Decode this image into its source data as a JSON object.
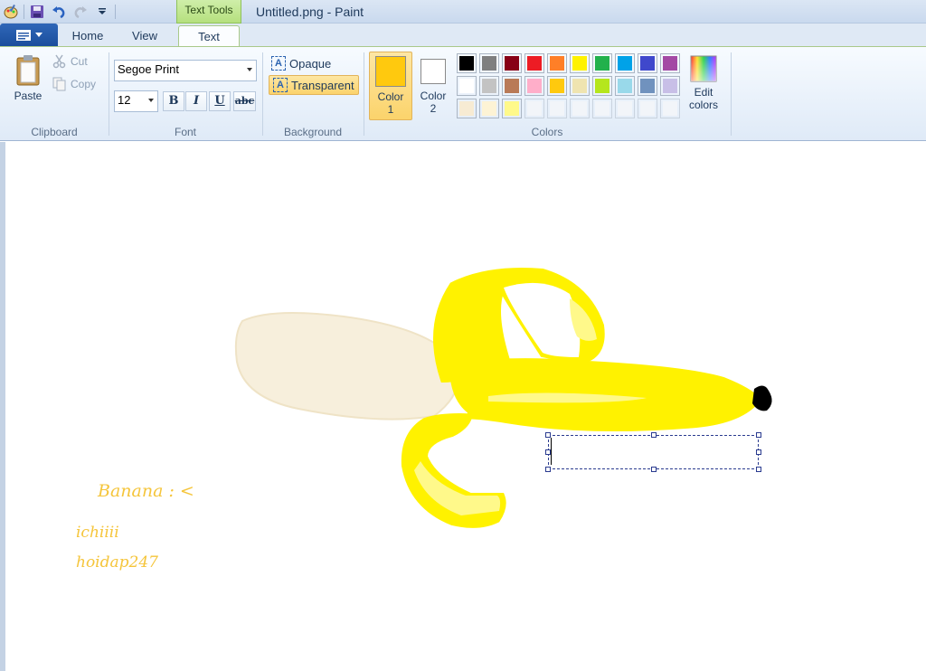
{
  "window": {
    "title": "Untitled.png - Paint",
    "context_tab": "Text Tools"
  },
  "tabs": [
    {
      "label": "Home"
    },
    {
      "label": "View"
    },
    {
      "label": "Text"
    }
  ],
  "clipboard": {
    "paste": "Paste",
    "cut": "Cut",
    "copy": "Copy",
    "group": "Clipboard"
  },
  "font": {
    "family": "Segoe Print",
    "size": "12",
    "bold": "B",
    "italic": "I",
    "underline": "U",
    "strike": "abc",
    "group": "Font"
  },
  "background": {
    "opaque": "Opaque",
    "transparent": "Transparent",
    "group": "Background"
  },
  "colors": {
    "color1_label": "Color",
    "color1_num": "1",
    "color2_label": "Color",
    "color2_num": "2",
    "edit_line1": "Edit",
    "edit_line2": "colors",
    "group": "Colors",
    "color1": "#ffc90e",
    "color2": "#ffffff",
    "palette_row1": [
      "#000000",
      "#7f7f7f",
      "#880015",
      "#ed1c24",
      "#ff7f27",
      "#fff200",
      "#22b14c",
      "#00a2e8",
      "#3f48cc",
      "#a349a4"
    ],
    "palette_row2": [
      "#ffffff",
      "#c3c3c3",
      "#b97a57",
      "#ffaec9",
      "#ffc90e",
      "#efe4b0",
      "#b5e61d",
      "#99d9ea",
      "#7092be",
      "#c8bfe7"
    ],
    "palette_row3": [
      "#f7ebd3",
      "#fdf3d5",
      "#fff98a",
      "",
      "",
      "",
      "",
      "",
      "",
      ""
    ]
  },
  "canvas": {
    "text1": "Banana : <",
    "text2": "ichiiii",
    "text3": "hoidap247",
    "text_color": "#f5c53b"
  }
}
